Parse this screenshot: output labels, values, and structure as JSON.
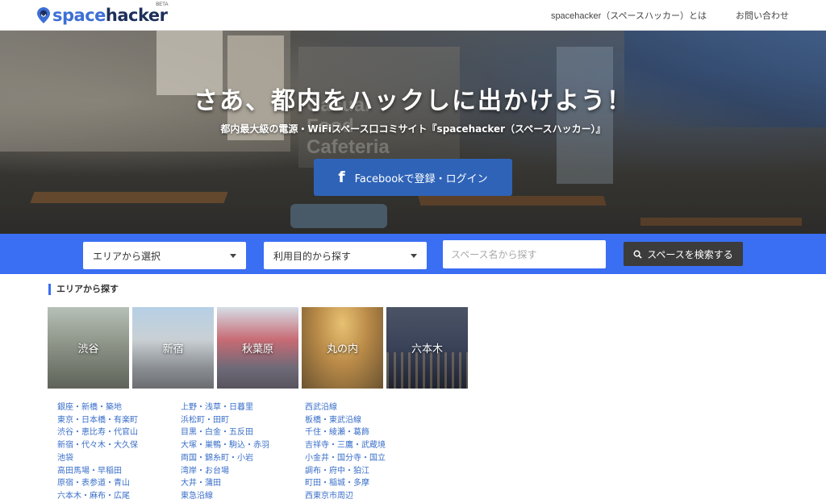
{
  "header": {
    "logo": {
      "part1": "space",
      "part2": "hacker",
      "badge": "BETA"
    },
    "nav": [
      {
        "label": "spacehacker（スペースハッカー）とは"
      },
      {
        "label": "お問い合わせ"
      }
    ]
  },
  "hero": {
    "title": "さあ、都内をハックしに出かけよう！",
    "subtitle": "都内最大級の電源・WiFiスペース口コミサイト『spacehacker（スペースハッカー）』",
    "fb_button": {
      "icon": "f",
      "label": "Facebookで登録・ログイン"
    },
    "background_sign": "Casual Food Cafeteria"
  },
  "search": {
    "area_select": "エリアから選択",
    "purpose_select": "利用目的から探す",
    "name_placeholder": "スペース名から探す",
    "button_label": "スペースを検索する"
  },
  "areas": {
    "section_title": "エリアから探す",
    "tiles": [
      {
        "label": "渋谷"
      },
      {
        "label": "新宿"
      },
      {
        "label": "秋葉原"
      },
      {
        "label": "丸の内"
      },
      {
        "label": "六本木"
      }
    ],
    "columns": [
      [
        "銀座・新橋・築地",
        "東京・日本橋・有楽町",
        "渋谷・恵比寿・代官山",
        "新宿・代々木・大久保",
        "池袋",
        "高田馬場・早稲田",
        "原宿・表参道・青山",
        "六本木・麻布・広尾"
      ],
      [
        "上野・浅草・日暮里",
        "浜松町・田町",
        "目黒・白金・五反田",
        "大塚・巣鴨・駒込・赤羽",
        "両国・錦糸町・小岩",
        "湾岸・お台場",
        "大井・蒲田",
        "東急沿線"
      ],
      [
        "西武沿線",
        "板橋・東武沿線",
        "千住・綾瀬・葛飾",
        "吉祥寺・三鷹・武蔵境",
        "小金井・国分寺・国立",
        "調布・府中・狛江",
        "町田・稲城・多摩",
        "西東京市周辺"
      ]
    ]
  },
  "colors": {
    "accent": "#3a6ef3",
    "facebook": "#2e63b8",
    "link": "#3a6fc8",
    "search_button": "#3c3c3c"
  }
}
